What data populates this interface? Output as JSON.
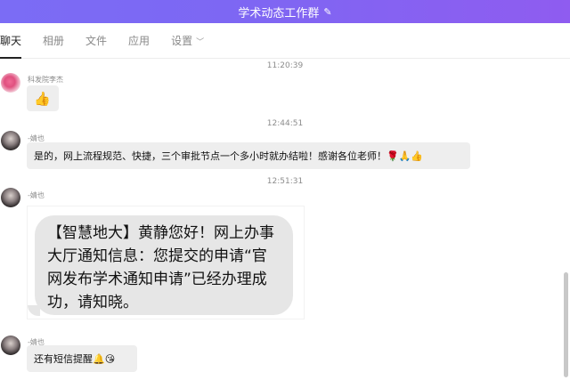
{
  "window": {
    "title": "学术动态工作群",
    "edit_icon": "✎"
  },
  "tabs": [
    {
      "label": "聊天",
      "active": true
    },
    {
      "label": "相册"
    },
    {
      "label": "文件"
    },
    {
      "label": "应用"
    },
    {
      "label": "设置",
      "chevron": "﹀"
    }
  ],
  "messages": [
    {
      "time": "11:20:39",
      "sender": "科发院李杰",
      "text": "👍"
    },
    {
      "time": "12:44:51",
      "sender": "-婧也",
      "text": "是的，网上流程规范、快捷，三个审批节点一个多小时就办结啦！感谢各位老师！🌹🙏👍"
    },
    {
      "time": "12:51:31",
      "sender": "-婧也",
      "sms_image_text": "【智慧地大】黄静您好！网上办事大厅通知信息：您提交的申请“官网发布学术通知申请”已经办理成功，请知晓。"
    },
    {
      "sender": "-婧也",
      "text": "还有短信提醒🔔😘"
    }
  ],
  "colors": {
    "titlebar_start": "#7b6cf5",
    "titlebar_end": "#8f5cf0",
    "bubble": "#eeeeee"
  }
}
